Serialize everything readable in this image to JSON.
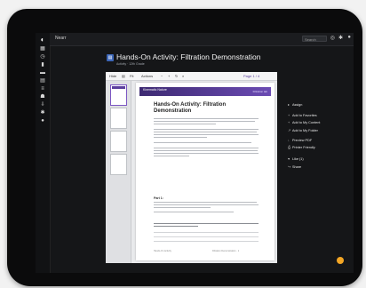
{
  "topbar": {
    "crumb": "Nearr",
    "search_placeholder": "Search"
  },
  "rail": {
    "icons": [
      "logo-icon",
      "grid-icon",
      "clock-icon",
      "bookmark-icon",
      "folder-icon",
      "chart-icon",
      "list-icon",
      "people-icon",
      "download-icon",
      "settings-icon",
      "user-icon"
    ]
  },
  "header": {
    "title": "Hands-On Activity: Filtration Demonstration",
    "subtitle": "Activity · 12th Grade"
  },
  "viewer": {
    "toolbar": [
      "Hide",
      "▤",
      "Fit",
      "Actions",
      "−",
      "+",
      "↻",
      "⌕"
    ],
    "page_label": "Page 1 / 4",
    "banner_brand": "Kinematic Nature",
    "banner_tag": "Filtration lab",
    "doc_title": "Hands-On Activity: Filtration Demonstration",
    "section": "Part 1:",
    "footer_left": "Hands-On Activity",
    "footer_right": "Filtration Demonstration · 1"
  },
  "menu": {
    "items": [
      {
        "glyph": "▸",
        "label": "Assign"
      },
      {
        "glyph": "+",
        "label": "Add to Favorites"
      },
      {
        "glyph": "+",
        "label": "Add to My Content"
      },
      {
        "glyph": "↗",
        "label": "Add to My Folder"
      },
      {
        "glyph": "↓",
        "label": "Preview PDF"
      },
      {
        "glyph": "⎙",
        "label": "Printer Friendly"
      },
      {
        "glyph": "♥",
        "label": "Like (1)"
      },
      {
        "glyph": "↪",
        "label": "Share"
      }
    ]
  }
}
